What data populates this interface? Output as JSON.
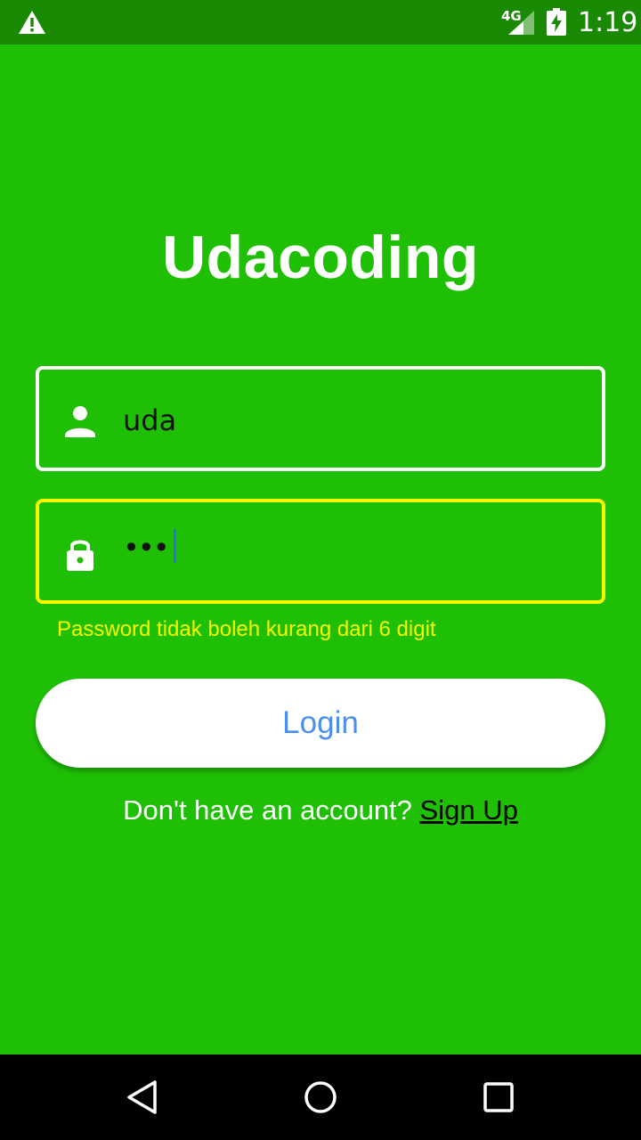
{
  "status_bar": {
    "network": "4G",
    "time": "1:19"
  },
  "app": {
    "title": "Udacoding"
  },
  "username_field": {
    "value": "uda",
    "icon": "person-icon"
  },
  "password_field": {
    "value": "•••",
    "icon": "lock-icon",
    "error": "Password tidak boleh kurang dari 6 digit"
  },
  "login_button": {
    "label": "Login"
  },
  "signup": {
    "prompt": "Don't have an account? ",
    "link": "Sign Up"
  },
  "colors": {
    "background": "#1fbf05",
    "status_bar": "#1a8a05",
    "error": "#f7f700",
    "button_text": "#4a8ef0"
  }
}
